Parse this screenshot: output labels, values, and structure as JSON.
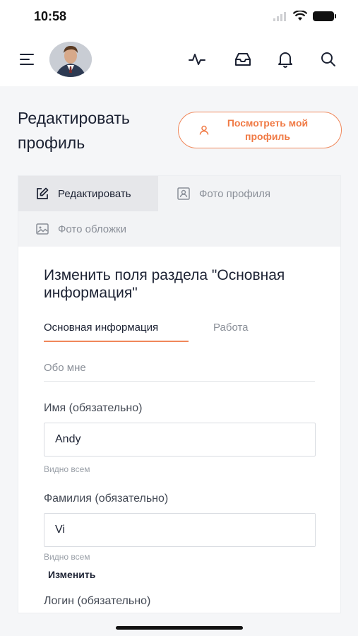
{
  "status_bar": {
    "time": "10:58"
  },
  "header": {
    "icons": [
      "menu-icon",
      "activity-icon",
      "inbox-icon",
      "bell-icon",
      "search-icon"
    ]
  },
  "page": {
    "title": "Редактировать профиль",
    "view_profile_label": "Посмотреть мой профиль"
  },
  "tabs": [
    {
      "label": "Редактировать",
      "icon": "edit-icon",
      "active": true
    },
    {
      "label": "Фото профиля",
      "icon": "profile-photo-icon",
      "active": false
    },
    {
      "label": "Фото обложки",
      "icon": "image-icon",
      "active": false
    }
  ],
  "form": {
    "title": "Изменить поля раздела \"Основная информация\"",
    "subtabs": [
      "Основная информация",
      "Работа"
    ],
    "about_placeholder": "Обо мне",
    "first_name_label": "Имя (обязательно)",
    "first_name_value": "Andy",
    "first_name_hint": "Видно всем",
    "last_name_label": "Фамилия (обязательно)",
    "last_name_value": "Vi",
    "last_name_hint": "Видно всем",
    "change_label": "Изменить",
    "login_label": "Логин (обязательно)"
  },
  "colors": {
    "accent": "#f0875a",
    "text": "#1c2233",
    "muted": "#8a8f98"
  }
}
